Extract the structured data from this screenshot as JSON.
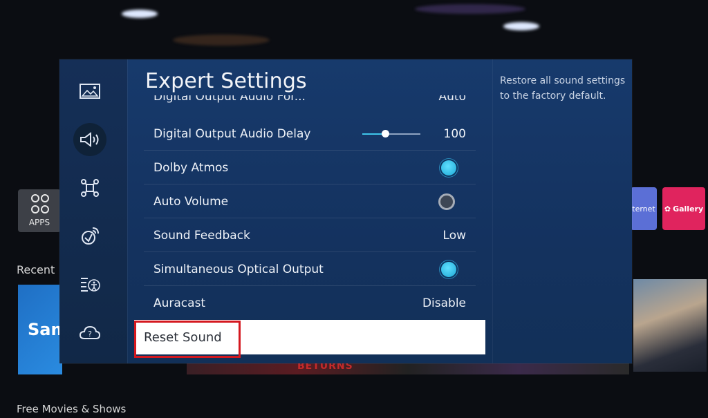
{
  "background": {
    "apps_label": "APPS",
    "recent_label": "Recent",
    "recent_card_text": "Sam",
    "internet_label": "ternet",
    "gallery_label": "Gallery",
    "free_label": "Free Movies & Shows",
    "strip_text": "BETURNS"
  },
  "panel": {
    "title": "Expert Settings",
    "help_text": "Restore all sound settings to the factory default.",
    "rail_icons": [
      "picture-icon",
      "sound-icon",
      "connection-icon",
      "support-remote-icon",
      "accessibility-icon",
      "help-cloud-icon"
    ],
    "cut_row": {
      "label": "Digital Output Audio For...",
      "value": "Auto"
    },
    "rows": [
      {
        "label": "Digital Output Audio Delay",
        "value": "100",
        "control": "slider",
        "level": 0.4
      },
      {
        "label": "Dolby Atmos",
        "control": "toggle",
        "on": true
      },
      {
        "label": "Auto Volume",
        "control": "toggle",
        "on": false
      },
      {
        "label": "Sound Feedback",
        "value": "Low",
        "control": "value"
      },
      {
        "label": "Simultaneous Optical Output",
        "control": "toggle",
        "on": true
      },
      {
        "label": "Auracast",
        "value": "Disable",
        "control": "value"
      }
    ],
    "reset_label": "Reset Sound"
  },
  "colors": {
    "panel": "#14325f",
    "accent": "#3fc6ea",
    "highlight": "#d4181f"
  }
}
